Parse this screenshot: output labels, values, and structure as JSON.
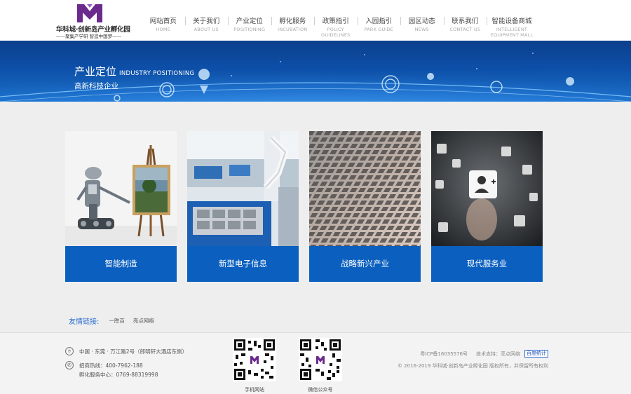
{
  "header": {
    "logo_name": "华科城·创新岛产业孵化园",
    "logo_slogan": "——聚集产学研   智造中国梦——",
    "nav": [
      {
        "cn": "网站首页",
        "en": "HOME"
      },
      {
        "cn": "关于我们",
        "en": "ABOUT US"
      },
      {
        "cn": "产业定位",
        "en": "POSITIONING"
      },
      {
        "cn": "孵化服务",
        "en": "INCUBATION"
      },
      {
        "cn": "政策指引",
        "en": "POLICY GUIDELINES"
      },
      {
        "cn": "入园指引",
        "en": "PARK GUIDE"
      },
      {
        "cn": "园区动态",
        "en": "NEWS"
      },
      {
        "cn": "联系我们",
        "en": "CONTACT US"
      },
      {
        "cn": "智能设备商城",
        "en": "INTELLIGENT EQUIPMENT MALL"
      }
    ]
  },
  "banner": {
    "title": "产业定位",
    "title_en": "INDUSTRY POSITIONING",
    "subtitle": "高新科技企业"
  },
  "cards": [
    {
      "label": "智能制造"
    },
    {
      "label": "新型电子信息"
    },
    {
      "label": "战略新兴产业"
    },
    {
      "label": "现代服务业"
    }
  ],
  "links": {
    "title": "友情链接:",
    "items": [
      "一胜百",
      "亮点网络"
    ]
  },
  "footer": {
    "address": "中国 · 东莞 · 万江路2号（郎明轩大酒店东侧）",
    "hotline": "招商热线：400-7962-188",
    "service": "孵化服务中心：0769-88319998",
    "qr_mobile_label": "手机网站",
    "qr_wechat_label": "微信公众号",
    "icp": "粤ICP备16035576号",
    "support": "技术支持：亮点网络",
    "stats_badge": "百度统计",
    "copyright": "© 2016-2019 华科城·创新岛产业孵化园 版权所有，并保留所有权利"
  },
  "colors": {
    "accent": "#0a5fbf",
    "logo_purple": "#6b2a8c",
    "banner_blue": "#0d4fa8"
  }
}
